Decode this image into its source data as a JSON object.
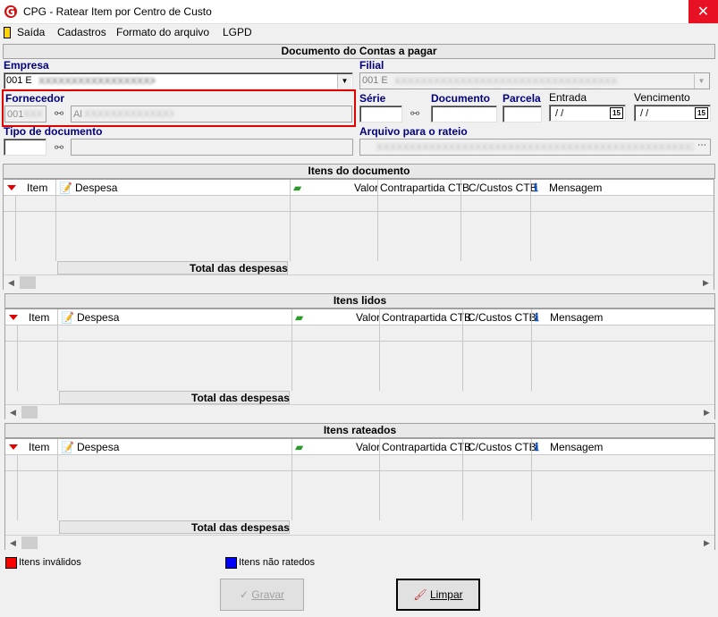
{
  "window": {
    "title": "CPG - Ratear Item por Centro de Custo",
    "close_glyph": "✕"
  },
  "menu": {
    "items": [
      "Saída",
      "Cadastros",
      "Formato do arquivo",
      "LGPD"
    ]
  },
  "header_panel": {
    "title": "Documento do Contas a pagar",
    "empresa": {
      "label": "Empresa",
      "value": "001 E"
    },
    "filial": {
      "label": "Filial",
      "value": "001 E"
    },
    "fornecedor": {
      "label": "Fornecedor",
      "code": "001",
      "name": "Al"
    },
    "serie": {
      "label": "Série"
    },
    "documento": {
      "label": "Documento"
    },
    "parcela": {
      "label": "Parcela"
    },
    "entrada": {
      "label": "Entrada",
      "value": " / /"
    },
    "vencimento": {
      "label": "Vencimento",
      "value": " / /"
    },
    "calendar_glyph": "15",
    "tipo_documento": {
      "label": "Tipo de documento"
    },
    "arquivo_rateio": {
      "label": "Arquivo para o rateio"
    }
  },
  "grids": [
    {
      "title": "Itens do documento"
    },
    {
      "title": "Itens lidos"
    },
    {
      "title": "Itens rateados"
    }
  ],
  "grid_columns": {
    "item": "Item",
    "despesa": "Despesa",
    "valor": "Valor",
    "contrapartida": "Contrapartida CTB",
    "ccustos": "C/Custos CTB",
    "mensagem": "Mensagem"
  },
  "total_label": "Total das despesas",
  "legend": [
    {
      "label": "Itens inválidos",
      "color": "#ff0000"
    },
    {
      "label": "Itens não ratedos",
      "color": "#0000ff"
    }
  ],
  "buttons": {
    "gravar": "Gravar",
    "limpar": "Limpar"
  },
  "colors": {
    "highlight": "#e00000",
    "label_blue": "#000080"
  }
}
